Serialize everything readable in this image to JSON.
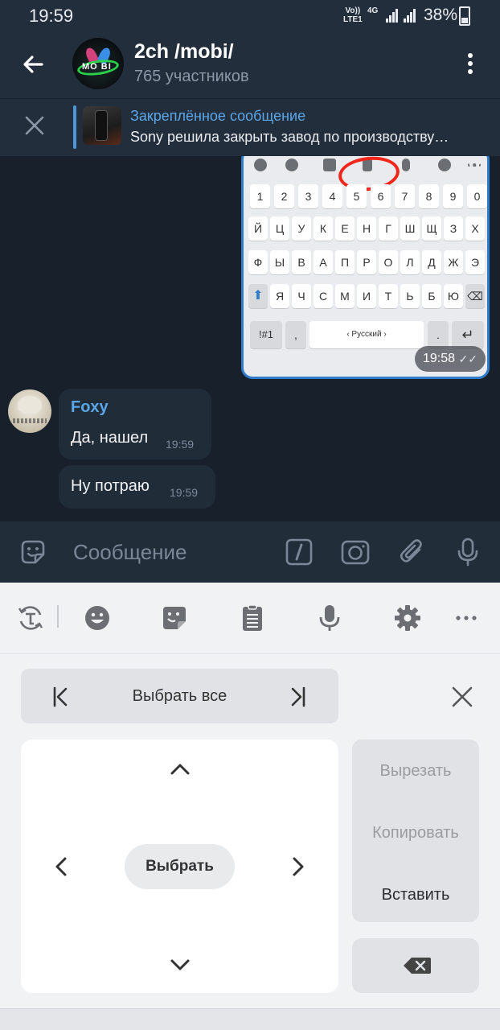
{
  "status_bar": {
    "time": "19:59",
    "volte": "Vo))\nLTE1",
    "network": "4G",
    "battery": "38%"
  },
  "header": {
    "title": "2ch /mobi/",
    "members": "765 участников",
    "avatar_text": "MO BI"
  },
  "pinned": {
    "title": "Закреплённое сообщение",
    "text": "Sony решила закрыть завод по производству…"
  },
  "image_message": {
    "time": "19:58",
    "keyboard": {
      "digits": [
        "1",
        "2",
        "3",
        "4",
        "5",
        "6",
        "7",
        "8",
        "9",
        "0"
      ],
      "row1": [
        "Й",
        "Ц",
        "У",
        "К",
        "Е",
        "Н",
        "Г",
        "Ш",
        "Щ",
        "З",
        "Х"
      ],
      "row2": [
        "Ф",
        "Ы",
        "В",
        "А",
        "П",
        "Р",
        "О",
        "Л",
        "Д",
        "Ж",
        "Э"
      ],
      "row3": [
        "Я",
        "Ч",
        "С",
        "М",
        "И",
        "Т",
        "Ь",
        "Б",
        "Ю"
      ],
      "symbols_key": "!#1",
      "comma_key": ",",
      "space_label": "‹ Русский ›",
      "period_key": "."
    }
  },
  "messages": [
    {
      "sender": "Foxy",
      "text": "Да, нашел",
      "time": "19:59"
    },
    {
      "text": "Ну потраю",
      "time": "19:59"
    }
  ],
  "composer": {
    "placeholder": "Сообщение"
  },
  "keyboard_toolbar": {
    "icons": [
      "translate-icon",
      "emoji-icon",
      "sticker-icon",
      "clipboard-icon",
      "microphone-icon",
      "settings-icon",
      "more-icon"
    ]
  },
  "text_edit_panel": {
    "select_all": "Выбрать все",
    "select": "Выбрать",
    "cut": "Вырезать",
    "copy": "Копировать",
    "paste": "Вставить"
  },
  "colors": {
    "accent": "#5aa6e8",
    "header_bg": "#232e3c",
    "chat_bg": "#18202b",
    "annotation": "#f0261b"
  }
}
